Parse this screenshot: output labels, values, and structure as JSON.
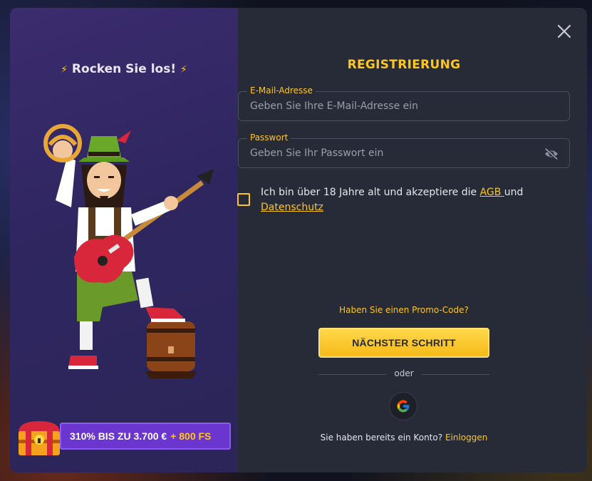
{
  "promo_panel": {
    "slogan": "Rocken Sie los!",
    "bonus_main": "310% BIS ZU 3.700 €",
    "bonus_extra": "+ 800 FS"
  },
  "form": {
    "title": "REGISTRIERUNG",
    "email": {
      "label": "E-Mail-Adresse",
      "placeholder": "Geben Sie Ihre E-Mail-Adresse ein",
      "value": ""
    },
    "password": {
      "label": "Passwort",
      "placeholder": "Geben Sie Ihr Passwort ein",
      "value": ""
    },
    "terms": {
      "text_before": "Ich bin über 18 Jahre alt und akzeptiere die ",
      "agb_link": "AGB ",
      "text_and": "und",
      "privacy_link": "Datenschutz",
      "checked": false
    },
    "promo_code_link": "Haben Sie einen Promo-Code?",
    "next_button": "NÄCHSTER SCHRITT",
    "divider_text": "oder",
    "social": [
      "google-icon"
    ],
    "login_prompt": "Sie haben bereits ein Konto?",
    "login_link": "Einloggen"
  },
  "icons": {
    "close": "close-icon",
    "password_visibility": "eye-off-icon"
  },
  "colors": {
    "accent": "#ffc71b",
    "modal_bg": "#272a37",
    "promo_panel_bg": "#2f2660",
    "bonus_bg": "#6a36cf"
  }
}
